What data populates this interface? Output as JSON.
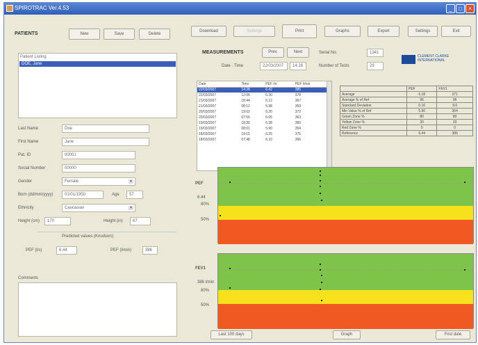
{
  "window": {
    "title": "SPIROTRAC Ver.4.53"
  },
  "patients": {
    "header": "PATIENTS",
    "buttons": [
      "New",
      "Save",
      "Delete"
    ],
    "list_title": "Patient Listing",
    "selected_patient": "DOE, Jane",
    "fields": [
      {
        "label": "Last Name",
        "value": "Doe"
      },
      {
        "label": "First Name",
        "value": "Jane"
      },
      {
        "label": "Pat. ID",
        "value": "00001"
      },
      {
        "label": "Social Number",
        "value": "00000"
      },
      {
        "label": "Gender",
        "value": "Female"
      },
      {
        "label": "Born (dd/mm/yyyy)",
        "value": "01/01/1950"
      },
      {
        "label": "Ethnicity",
        "value": "Caucasian"
      }
    ],
    "age_label": "Age",
    "age_value": "57",
    "height_cm_label": "Height (cm)",
    "height_cm_value": "170",
    "height_in_label": "Height (in)",
    "height_in_value": "67",
    "predicted_caption": "Predicted values (Knudson):",
    "pef_label": "PEF (l/s)",
    "pef_value": "6.44",
    "fev_label": "PEF (l/min)",
    "fev_value": "386",
    "comments_label": "Comments"
  },
  "toolbar": {
    "buttons": [
      "Download",
      "Settings",
      "Print",
      "Graphs",
      "Export",
      "Settings",
      "Exit"
    ]
  },
  "measurements": {
    "header": "MEASUREMENTS",
    "prev_label": "Prev.",
    "next_label": "Next",
    "datetime_label": "Date · Time",
    "date_value": "22/03/2007",
    "time_value": "14:28",
    "serial_label": "Serial No.",
    "serial_value": "1341",
    "days_label": "Number of Tests",
    "days_value": "29",
    "columns": [
      "Date",
      "Time",
      "PEF l/s",
      "PEF l/min"
    ],
    "rows": [
      [
        "22/03/2007",
        "14:28",
        "6.42",
        "385"
      ],
      [
        "22/03/2007",
        "12:06",
        "6.30",
        "378"
      ],
      [
        "21/03/2007",
        "18:44",
        "6.12",
        "367"
      ],
      [
        "21/03/2007",
        "08:12",
        "5.98",
        "359"
      ],
      [
        "20/03/2007",
        "19:02",
        "6.20",
        "372"
      ],
      [
        "20/03/2007",
        "07:55",
        "6.05",
        "363"
      ],
      [
        "19/03/2007",
        "18:30",
        "6.38",
        "383"
      ],
      [
        "19/03/2007",
        "08:01",
        "5.90",
        "354"
      ],
      [
        "18/03/2007",
        "19:15",
        "6.25",
        "375"
      ],
      [
        "18/03/2007",
        "07:48",
        "6.10",
        "366"
      ]
    ]
  },
  "logo": {
    "line1": "CLEMENT CLARKE",
    "line2": "INTERNATIONAL"
  },
  "stats": {
    "columns": [
      "",
      "PEF",
      "FEV1"
    ],
    "rows": [
      [
        "Average",
        "6.18",
        "371"
      ],
      [
        "Average % of Ref",
        "96",
        "96"
      ],
      [
        "Standard Deviation",
        "0.16",
        "9.6"
      ],
      [
        "Min Value % of Ref",
        "5.90",
        "354"
      ],
      [
        "Green Zone %",
        "80",
        "80"
      ],
      [
        "Yellow Zone %",
        "20",
        "20"
      ],
      [
        "Red Zone %",
        "0",
        "0"
      ],
      [
        "Reference",
        "6.44",
        "386"
      ]
    ]
  },
  "charts": [
    {
      "title": "PEF",
      "ref_label": "6.44",
      "y80": "80%",
      "y50": "50%"
    },
    {
      "title": "FEV1",
      "ref_label": "386 l/min",
      "y80": "80%",
      "y50": "50%"
    }
  ],
  "footer": {
    "left": "Last 100 days",
    "center": "Graph",
    "right": "First date"
  }
}
